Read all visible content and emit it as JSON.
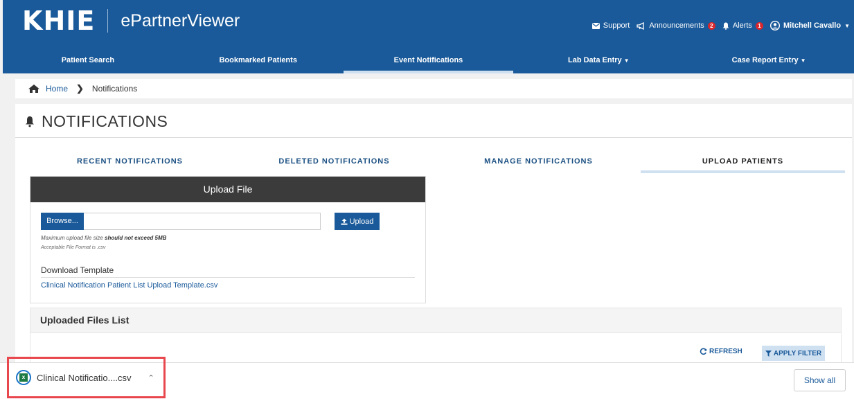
{
  "header": {
    "logo": "KHIE",
    "app_title": "ePartnerViewer",
    "support": "Support",
    "announcements": "Announcements",
    "announcements_count": "2",
    "alerts": "Alerts",
    "alerts_count": "1",
    "user": "Mitchell Cavallo"
  },
  "mainnav": {
    "tabs": [
      {
        "label": "Patient Search"
      },
      {
        "label": "Bookmarked Patients"
      },
      {
        "label": "Event Notifications"
      },
      {
        "label": "Lab Data Entry"
      },
      {
        "label": "Case Report Entry"
      }
    ]
  },
  "breadcrumb": {
    "home": "Home",
    "current": "Notifications"
  },
  "page": {
    "title": "NOTIFICATIONS",
    "subtabs": [
      {
        "label": "RECENT NOTIFICATIONS"
      },
      {
        "label": "DELETED NOTIFICATIONS"
      },
      {
        "label": "MANAGE NOTIFICATIONS"
      },
      {
        "label": "UPLOAD PATIENTS"
      }
    ]
  },
  "upload": {
    "header": "Upload File",
    "browse": "Browse...",
    "upload_button": "Upload",
    "hint_prefix": "Maximum upload file size ",
    "hint_bold": "should not exceed 5MB",
    "hint_format": "Acceptable File Format is .csv",
    "download_title": "Download Template",
    "download_link": "Clinical Notification Patient List Upload Template.csv"
  },
  "files": {
    "title": "Uploaded Files List",
    "refresh": "REFRESH",
    "apply_filter": "APPLY FILTER"
  },
  "download_bar": {
    "file_name": "Clinical Notificatio....csv",
    "show_all": "Show all"
  }
}
